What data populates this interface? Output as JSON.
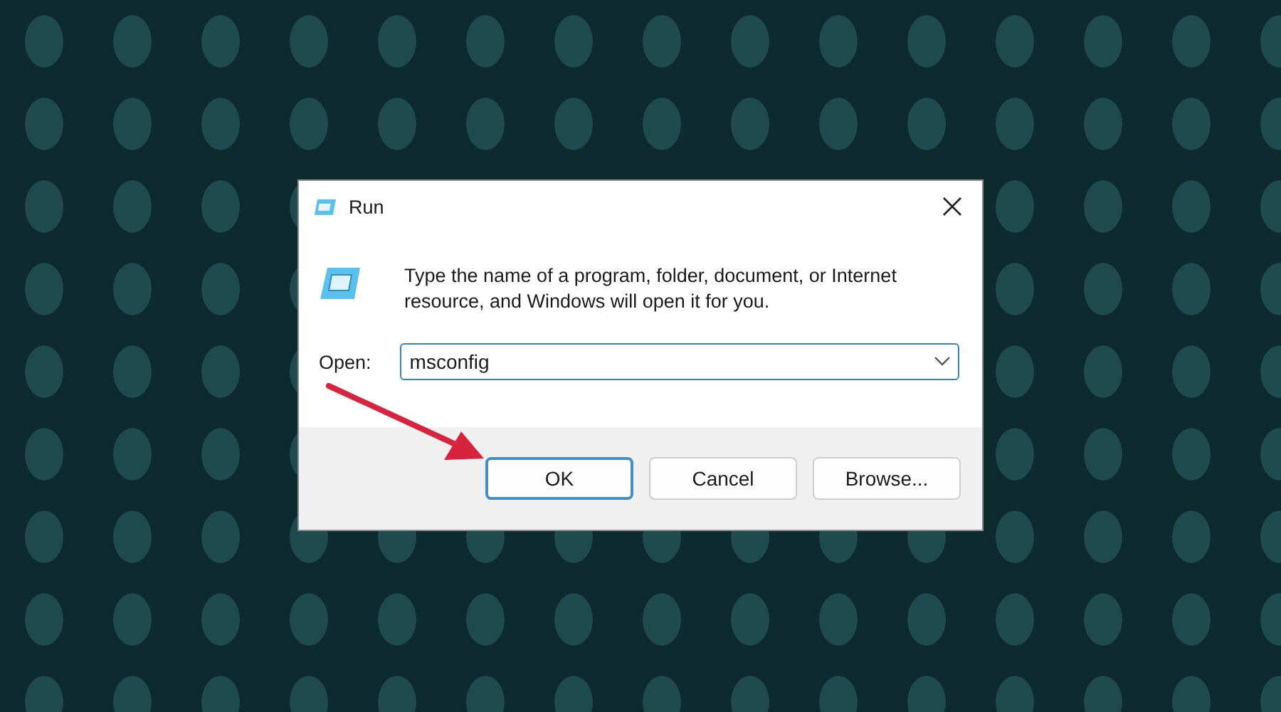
{
  "window": {
    "title": "Run"
  },
  "message": "Type the name of a program, folder, document, or Internet resource, and Windows will open it for you.",
  "open_field": {
    "label": "Open:",
    "value": "msconfig"
  },
  "buttons": [
    {
      "label": "OK",
      "default": true
    },
    {
      "label": "Cancel",
      "default": false
    },
    {
      "label": "Browse...",
      "default": false
    }
  ]
}
